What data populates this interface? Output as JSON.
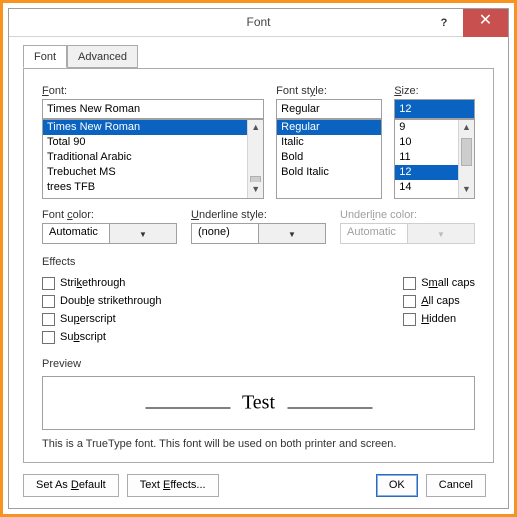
{
  "title": "Font",
  "tabs": {
    "font": "Font",
    "advanced": "Advanced"
  },
  "font": {
    "label": "Font:",
    "value": "Times New Roman",
    "items": [
      "Times New Roman",
      "Total 90",
      "Traditional Arabic",
      "Trebuchet MS",
      "trees TFB"
    ],
    "selectedIndex": 0
  },
  "style": {
    "label": "Font style:",
    "value": "Regular",
    "items": [
      "Regular",
      "Italic",
      "Bold",
      "Bold Italic"
    ],
    "selectedIndex": 0
  },
  "size": {
    "label": "Size:",
    "value": "12",
    "items": [
      "9",
      "10",
      "11",
      "12",
      "14"
    ],
    "selectedIndex": 3
  },
  "fontColor": {
    "label": "Font color:",
    "value": "Automatic"
  },
  "underlineStyle": {
    "label": "Underline style:",
    "value": "(none)"
  },
  "underlineColor": {
    "label": "Underline color:",
    "value": "Automatic"
  },
  "effectsLabel": "Effects",
  "effects": {
    "strike": "Strikethrough",
    "dstrike": "Double strikethrough",
    "super": "Superscript",
    "sub": "Subscript",
    "smallcaps": "Small caps",
    "allcaps": "All caps",
    "hidden": "Hidden"
  },
  "previewLabel": "Preview",
  "previewText": "Test",
  "infoText": "This is a TrueType font. This font will be used on both printer and screen.",
  "buttons": {
    "setDefault": "Set As Default",
    "textEffects": "Text Effects...",
    "ok": "OK",
    "cancel": "Cancel"
  }
}
